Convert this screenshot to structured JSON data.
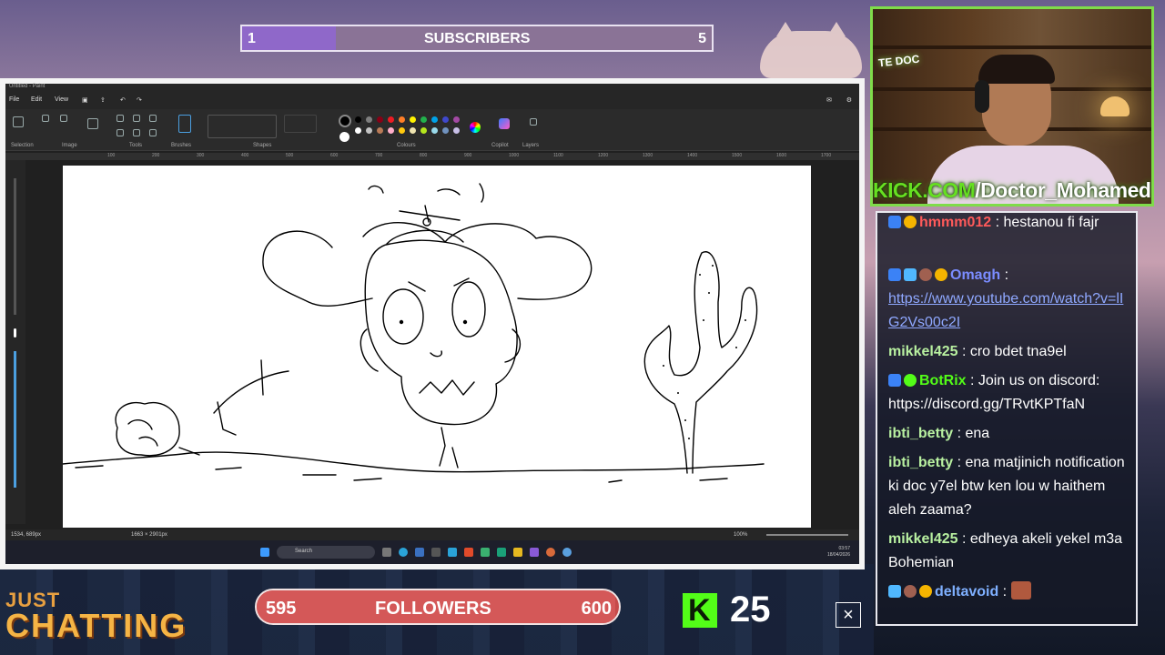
{
  "subscribers": {
    "current": "1",
    "label": "SUBSCRIBERS",
    "goal": "5",
    "progress": 0.2
  },
  "paint": {
    "title": "Untitled - Paint",
    "menu": [
      "File",
      "Edit",
      "View"
    ],
    "groups": [
      "Selection",
      "Image",
      "Tools",
      "Brushes",
      "Shapes",
      "Colours",
      "Copilot",
      "Layers"
    ],
    "ruler": [
      "100",
      "200",
      "300",
      "400",
      "500",
      "600",
      "700",
      "800",
      "900",
      "1000",
      "1100",
      "1200",
      "1300",
      "1400",
      "1500",
      "1600",
      "1700"
    ],
    "palette": [
      "#000000",
      "#7f7f7f",
      "#880015",
      "#ed1c24",
      "#ff7f27",
      "#fff200",
      "#22b14c",
      "#00a2e8",
      "#3f48cc",
      "#a349a4",
      "#ffffff",
      "#c3c3c3",
      "#b97a57",
      "#ffaec9",
      "#ffc90e",
      "#efe4b0",
      "#b5e61d",
      "#99d9ea",
      "#7092be",
      "#c8bfe7"
    ],
    "status": {
      "cursor": "1534, 689px",
      "size": "1663 × 2901px",
      "zoom": "100%"
    }
  },
  "taskbar": {
    "search": "Search",
    "time": "03:57",
    "date": "18/04/2026"
  },
  "webcam": {
    "neon": "TE DOC",
    "url": "KICK.COM/Doctor_Mohamed",
    "url_prefix": "KICK.COM",
    "url_path": "/Doctor_Mohamed"
  },
  "chat": [
    {
      "user": "hmmm012",
      "user_color": "#ff5a5a",
      "text": " : hestanou fi fajr"
    },
    {
      "user": "Omagh",
      "user_color": "#7a8cff",
      "text": " : ",
      "link": "https://www.youtube.com/watch?v=lIG2Vs00c2I"
    },
    {
      "user": "mikkel425",
      "user_color": "#b8f0a0",
      "text": " : cro bdet tna9el"
    },
    {
      "user": "BotRix",
      "user_color": "#53fc18",
      "text": " : Join us on discord: https://discord.gg/TRvtKPTfaN"
    },
    {
      "user": "ibti_betty",
      "user_color": "#b8f0a0",
      "text": " : ena"
    },
    {
      "user": "ibti_betty",
      "user_color": "#b8f0a0",
      "text": " : ena matjinich notification ki doc y7el btw ken lou w haithem aleh zaama?"
    },
    {
      "user": "mikkel425",
      "user_color": "#b8f0a0",
      "text": " : edheya akeli yekel m3a Bohemian"
    },
    {
      "user": "deltavoid",
      "user_color": "#7fb0ff",
      "text": " : "
    }
  ],
  "bottom": {
    "category_top": "JUST",
    "category_bottom": "CHATTING",
    "followers": {
      "current": "595",
      "label": "FOLLOWERS",
      "goal": "600",
      "progress": 0.99
    },
    "viewers": "25",
    "close": "×"
  },
  "colors": {
    "kick_green": "#53fc18",
    "sub_purple": "#8f68c9",
    "follow_red": "#c64a4a"
  }
}
